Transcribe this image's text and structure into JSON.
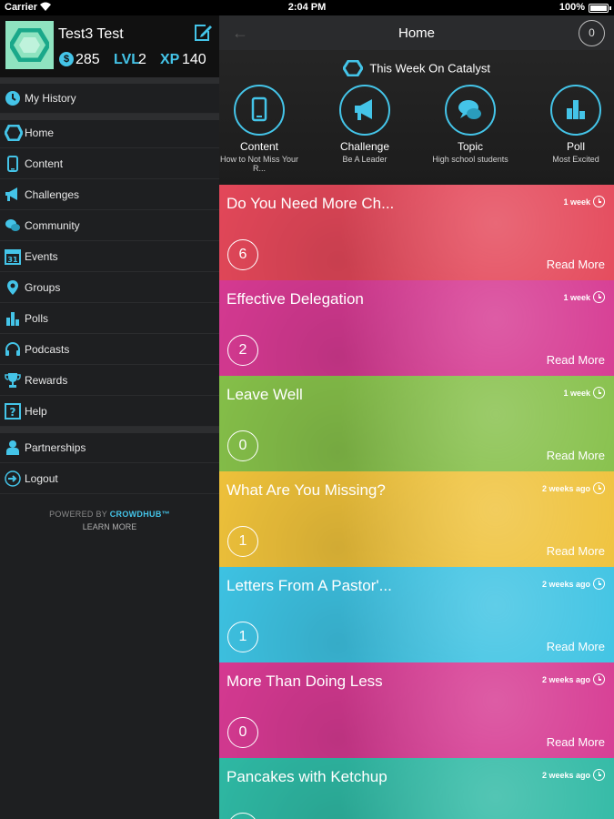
{
  "status_bar": {
    "carrier": "Carrier",
    "time": "2:04 PM",
    "battery": "100%"
  },
  "profile": {
    "name": "Test3 Test",
    "coin_symbol": "$",
    "coins": "285",
    "level_label": "LVL",
    "level": "2",
    "xp_label": "XP",
    "xp": "140"
  },
  "sidebar": {
    "history": "My History",
    "items": [
      {
        "label": "Home",
        "icon": "catalyst-logo-icon"
      },
      {
        "label": "Content",
        "icon": "phone-icon"
      },
      {
        "label": "Challenges",
        "icon": "megaphone-icon"
      },
      {
        "label": "Community",
        "icon": "chat-bubbles-icon"
      },
      {
        "label": "Events",
        "icon": "calendar-icon",
        "calendar_day": "31"
      },
      {
        "label": "Groups",
        "icon": "map-pin-icon"
      },
      {
        "label": "Polls",
        "icon": "bar-chart-icon"
      },
      {
        "label": "Podcasts",
        "icon": "headphones-icon"
      },
      {
        "label": "Rewards",
        "icon": "trophy-icon"
      },
      {
        "label": "Help",
        "icon": "question-icon"
      }
    ],
    "partnerships": "Partnerships",
    "logout": "Logout",
    "powered_by": "POWERED BY",
    "brand": "CROWDHUB™",
    "learn_more": "LEARN MORE"
  },
  "topnav": {
    "title": "Home",
    "counter": "0"
  },
  "week": {
    "header": "This Week On Catalyst",
    "features": [
      {
        "label": "Content",
        "sub": "How to Not Miss Your R...",
        "icon": "phone-icon"
      },
      {
        "label": "Challenge",
        "sub": "Be A Leader",
        "icon": "megaphone-icon"
      },
      {
        "label": "Topic",
        "sub": "High school students",
        "icon": "chat-bubbles-icon"
      },
      {
        "label": "Poll",
        "sub": "Most Excited",
        "icon": "bar-chart-icon"
      }
    ]
  },
  "read_more": "Read More",
  "cards": [
    {
      "title": "Do You Need More Ch...",
      "ago": "1 week",
      "count": "6",
      "color": "#e4485a"
    },
    {
      "title": "Effective Delegation",
      "ago": "1 week",
      "count": "2",
      "color": "#d63a92"
    },
    {
      "title": "Leave Well",
      "ago": "1 week",
      "count": "0",
      "color": "#86c04a"
    },
    {
      "title": "What Are You Missing?",
      "ago": "2 weeks ago",
      "count": "1",
      "color": "#efc23b"
    },
    {
      "title": "Letters From A Pastor'...",
      "ago": "2 weeks ago",
      "count": "1",
      "color": "#3ec3e3"
    },
    {
      "title": "More Than Doing Less",
      "ago": "2 weeks ago",
      "count": "0",
      "color": "#d63a92"
    },
    {
      "title": "Pancakes with Ketchup",
      "ago": "2 weeks ago",
      "count": "",
      "color": "#2fb9a4"
    }
  ],
  "colors": {
    "accent": "#44c4e8",
    "sidebar_bg": "#1e1f21",
    "avatar_bg": "#8fe3c0"
  }
}
